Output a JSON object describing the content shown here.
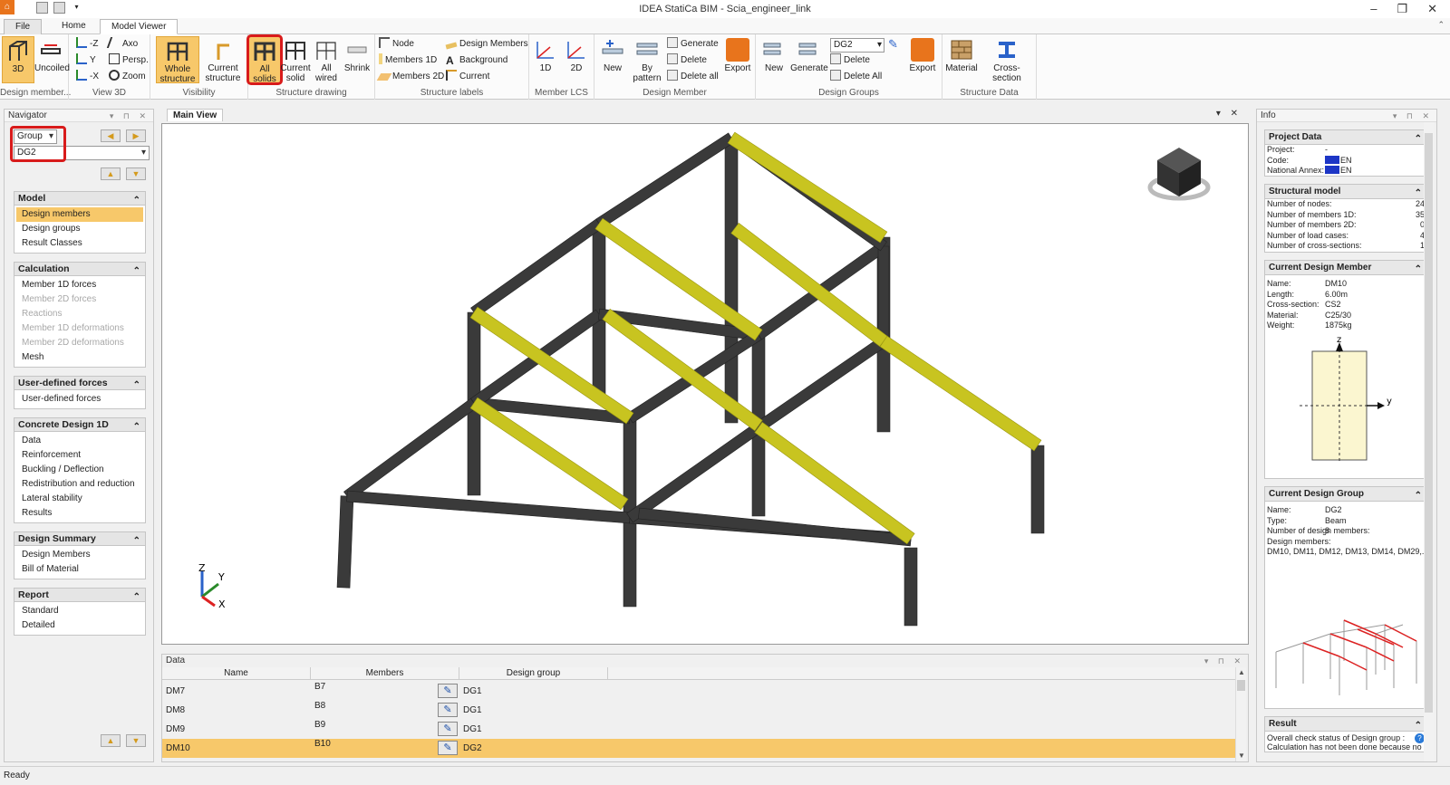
{
  "window": {
    "title": "IDEA StatiCa BIM - Scia_engineer_link",
    "minimize": "–",
    "maximize": "❐",
    "close": "✕"
  },
  "tabs": {
    "file": "File",
    "home": "Home",
    "model_viewer": "Model Viewer"
  },
  "ribbon": {
    "design_member_group": {
      "label": "Design member...",
      "b3d": "3D",
      "uncoiled": "Uncoiled"
    },
    "view3d": {
      "label": "View 3D",
      "minus_z": "-Z",
      "y": "Y",
      "minus_x": "-X",
      "axo": "Axo",
      "persp": "Persp.",
      "zoom": "Zoom"
    },
    "visibility": {
      "label": "Visibility",
      "whole_structure": "Whole structure",
      "current_structure": "Current structure"
    },
    "structure_drawing": {
      "label": "Structure drawing",
      "all_solids": "All solids",
      "current_solid": "Current solid",
      "all_wired": "All wired",
      "shrink": "Shrink"
    },
    "structure_labels": {
      "label": "Structure labels",
      "node": "Node",
      "members_1d": "Members 1D",
      "members_2d": "Members 2D",
      "design_members": "Design Members",
      "background": "Background",
      "current": "Current"
    },
    "member_lcs": {
      "label": "Member LCS",
      "one_d": "1D",
      "two_d": "2D"
    },
    "design_member": {
      "label": "Design Member",
      "new": "New",
      "by_pattern": "By pattern",
      "generate": "Generate",
      "delete": "Delete",
      "delete_all": "Delete all",
      "export": "Export"
    },
    "design_groups": {
      "label": "Design Groups",
      "new": "New",
      "generate": "Generate",
      "combo_value": "DG2",
      "delete": "Delete",
      "delete_all": "Delete All",
      "export": "Export"
    },
    "structure_data": {
      "label": "Structure Data",
      "material": "Material",
      "cross_section": "Cross-section"
    }
  },
  "navigator": {
    "title": "Navigator",
    "group_combo": "Group",
    "dg_combo": "DG2",
    "sections": [
      {
        "title": "Model",
        "items": [
          {
            "label": "Design members",
            "state": "selected"
          },
          {
            "label": "Design groups",
            "state": "normal"
          },
          {
            "label": "Result Classes",
            "state": "normal"
          }
        ]
      },
      {
        "title": "Calculation",
        "items": [
          {
            "label": "Member 1D forces",
            "state": "normal"
          },
          {
            "label": "Member 2D forces",
            "state": "disabled"
          },
          {
            "label": "Reactions",
            "state": "disabled"
          },
          {
            "label": "Member 1D deformations",
            "state": "disabled"
          },
          {
            "label": "Member 2D deformations",
            "state": "disabled"
          },
          {
            "label": "Mesh",
            "state": "normal"
          }
        ]
      },
      {
        "title": "User-defined forces",
        "items": [
          {
            "label": "User-defined forces",
            "state": "normal"
          }
        ]
      },
      {
        "title": "Concrete Design 1D",
        "items": [
          {
            "label": "Data",
            "state": "normal"
          },
          {
            "label": "Reinforcement",
            "state": "normal"
          },
          {
            "label": "Buckling / Deflection",
            "state": "normal"
          },
          {
            "label": "Redistribution and reduction",
            "state": "normal"
          },
          {
            "label": "Lateral stability",
            "state": "normal"
          },
          {
            "label": "Results",
            "state": "normal"
          }
        ]
      },
      {
        "title": "Design Summary",
        "items": [
          {
            "label": "Design Members",
            "state": "normal"
          },
          {
            "label": "Bill of Material",
            "state": "normal"
          }
        ]
      },
      {
        "title": "Report",
        "items": [
          {
            "label": "Standard",
            "state": "normal"
          },
          {
            "label": "Detailed",
            "state": "normal"
          }
        ]
      }
    ]
  },
  "main_view": {
    "tab": "Main View",
    "axis_z": "Z",
    "axis_y": "Y",
    "axis_x": "X",
    "colors": {
      "column": "#3a3a3a",
      "beam_highlight": "#c8c420"
    }
  },
  "data_panel": {
    "title": "Data",
    "columns": [
      "Name",
      "Members",
      "Design group"
    ],
    "rows": [
      {
        "name": "DM7",
        "members": "B7",
        "group": "DG1",
        "selected": false
      },
      {
        "name": "DM8",
        "members": "B8",
        "group": "DG1",
        "selected": false
      },
      {
        "name": "DM9",
        "members": "B9",
        "group": "DG1",
        "selected": false
      },
      {
        "name": "DM10",
        "members": "B10",
        "group": "DG2",
        "selected": true
      }
    ]
  },
  "info": {
    "title": "Info",
    "project_data": {
      "title": "Project Data",
      "project_label": "Project:",
      "project_value": "-",
      "code_label": "Code:",
      "code_value": "EN",
      "annex_label": "National Annex:",
      "annex_value": "EN"
    },
    "structural_model": {
      "title": "Structural model",
      "rows": [
        {
          "k": "Number of nodes:",
          "v": "24"
        },
        {
          "k": "Number of members 1D:",
          "v": "35"
        },
        {
          "k": "Number of members 2D:",
          "v": "0"
        },
        {
          "k": "Number of load cases:",
          "v": "4"
        },
        {
          "k": "Number of cross-sections:",
          "v": "1"
        }
      ]
    },
    "current_design_member": {
      "title": "Current Design Member",
      "rows": [
        {
          "k": "Name:",
          "v": "DM10"
        },
        {
          "k": "Length:",
          "v": "6.00m"
        },
        {
          "k": "Cross-section:",
          "v": "CS2"
        },
        {
          "k": "Material:",
          "v": "C25/30"
        },
        {
          "k": "Weight:",
          "v": "1875kg"
        }
      ],
      "axis_z": "z",
      "axis_y": "y"
    },
    "current_design_group": {
      "title": "Current Design Group",
      "rows": [
        {
          "k": "Name:",
          "v": "DG2"
        },
        {
          "k": "Type:",
          "v": "Beam"
        },
        {
          "k": "Number of design members:",
          "v": "8"
        }
      ],
      "members_label": "Design members:",
      "members_value": "DM10, DM11, DM12, DM13, DM14, DM29,..."
    },
    "result": {
      "title": "Result",
      "line1": "Overall check status of Design group :",
      "line2": "Calculation has not been done because no"
    }
  },
  "status": "Ready"
}
